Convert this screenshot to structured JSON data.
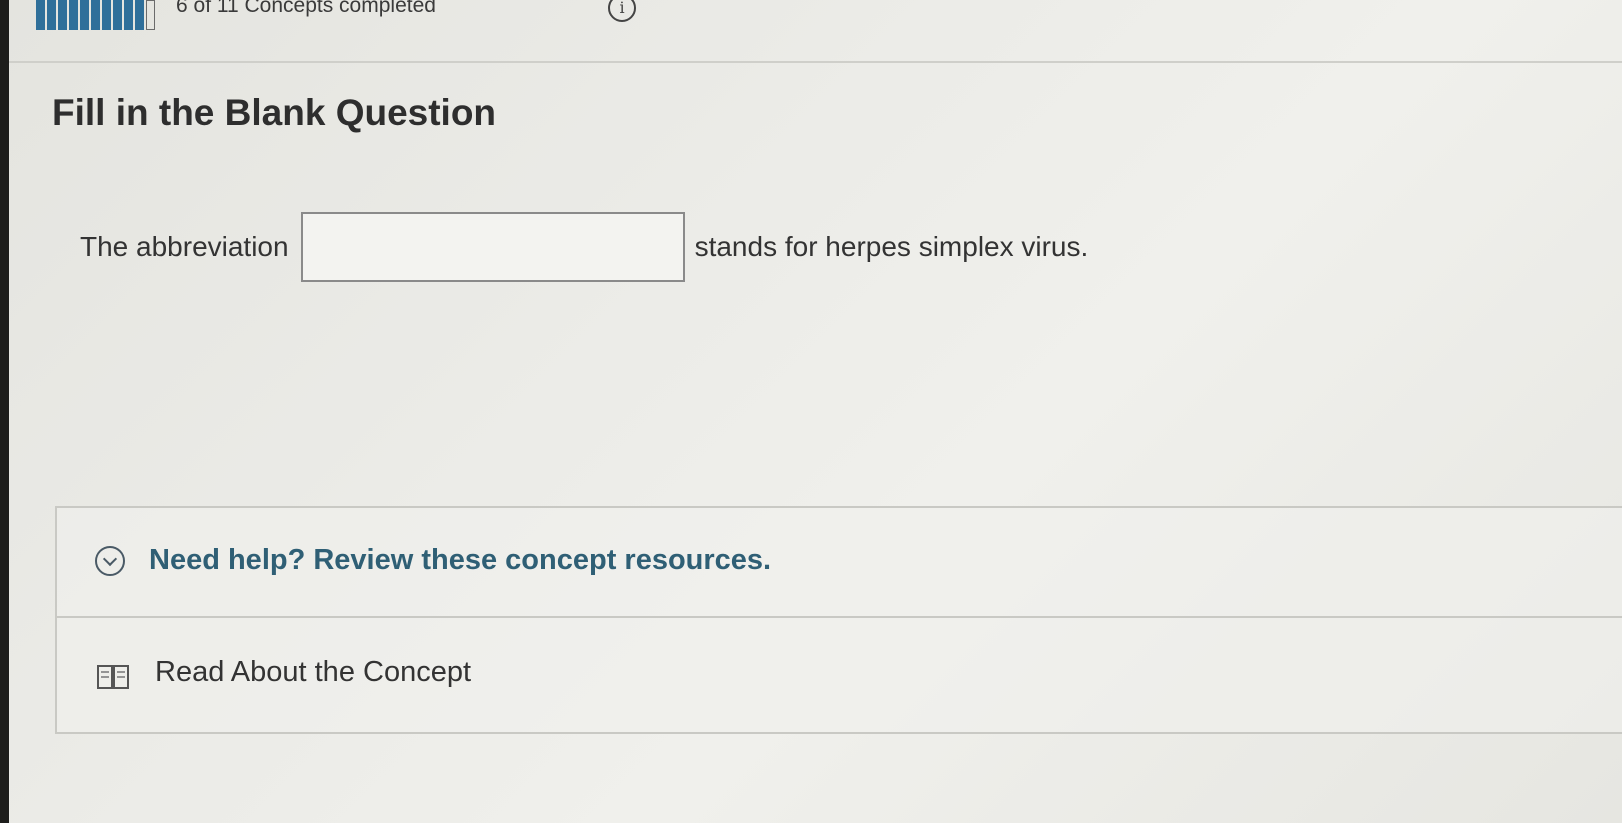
{
  "header": {
    "progress_text": "6 of 11 Concepts completed",
    "progress_completed": 6,
    "progress_total": 11,
    "info_icon_glyph": "i",
    "info_icon": "info-icon"
  },
  "question": {
    "type_title": "Fill in the Blank Question",
    "prompt_before": "The abbreviation",
    "blank_value": "",
    "prompt_after": "stands for herpes simplex virus."
  },
  "help": {
    "toggle_label": "Need help? Review these concept resources.",
    "toggle_icon": "chevron-down-icon",
    "resources": [
      {
        "label": "Read About the Concept",
        "icon": "book-icon"
      }
    ]
  },
  "colors": {
    "progress_fill": "#2f6f9a",
    "help_text": "#2f5f75"
  }
}
